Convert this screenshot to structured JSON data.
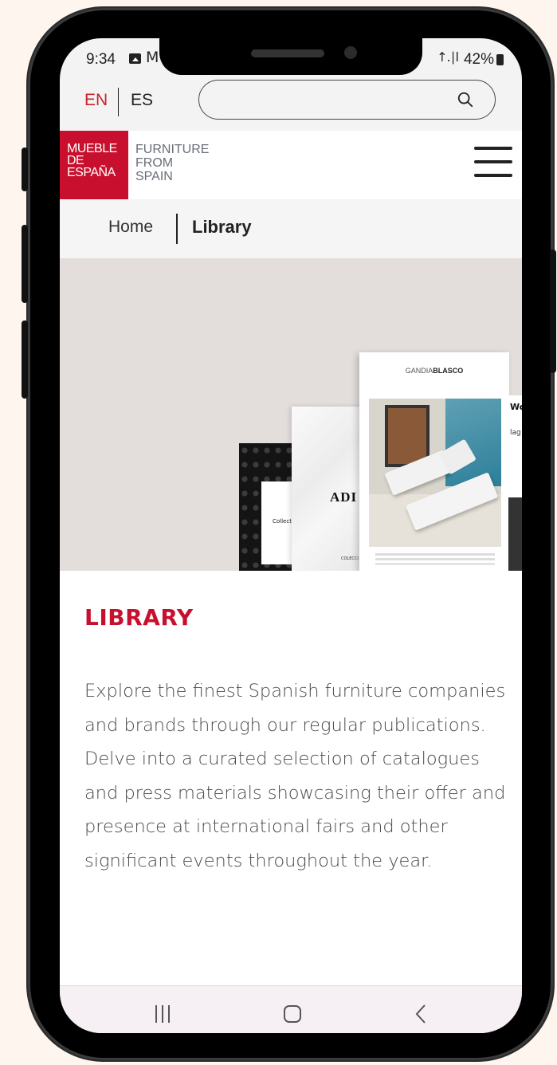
{
  "status_bar": {
    "time": "9:34",
    "mail_icon": "M",
    "signal": "↑.∣l",
    "battery": "42%"
  },
  "lang": {
    "en": "EN",
    "es": "ES",
    "active": "EN"
  },
  "search": {
    "placeholder": ""
  },
  "logo": {
    "es_lines": [
      "MUEBLE",
      "DE",
      "ESPAÑA"
    ],
    "en_lines": [
      "FURNITURE",
      "FROM",
      "SPAIN"
    ]
  },
  "breadcrumb": {
    "home": "Home",
    "current": "Library"
  },
  "hero": {
    "book1_label": "Collect",
    "book2_title": "ADI",
    "book2_footer": "COLECCI",
    "book3_brand_a": "GANDIA",
    "book3_brand_b": "BLASCO",
    "book4_title": "Wo",
    "book4_sub": "lag"
  },
  "library": {
    "title": "LIBRARY",
    "description": "Explore the finest Spanish furniture companies and brands through our regular publications. Delve into a curated selection of catalogues and press materials showcasing their offer and presence at international fairs and other significant events throughout the year."
  },
  "colors": {
    "brand_red": "#c8102e",
    "page_bg": "#fdf5ee"
  }
}
